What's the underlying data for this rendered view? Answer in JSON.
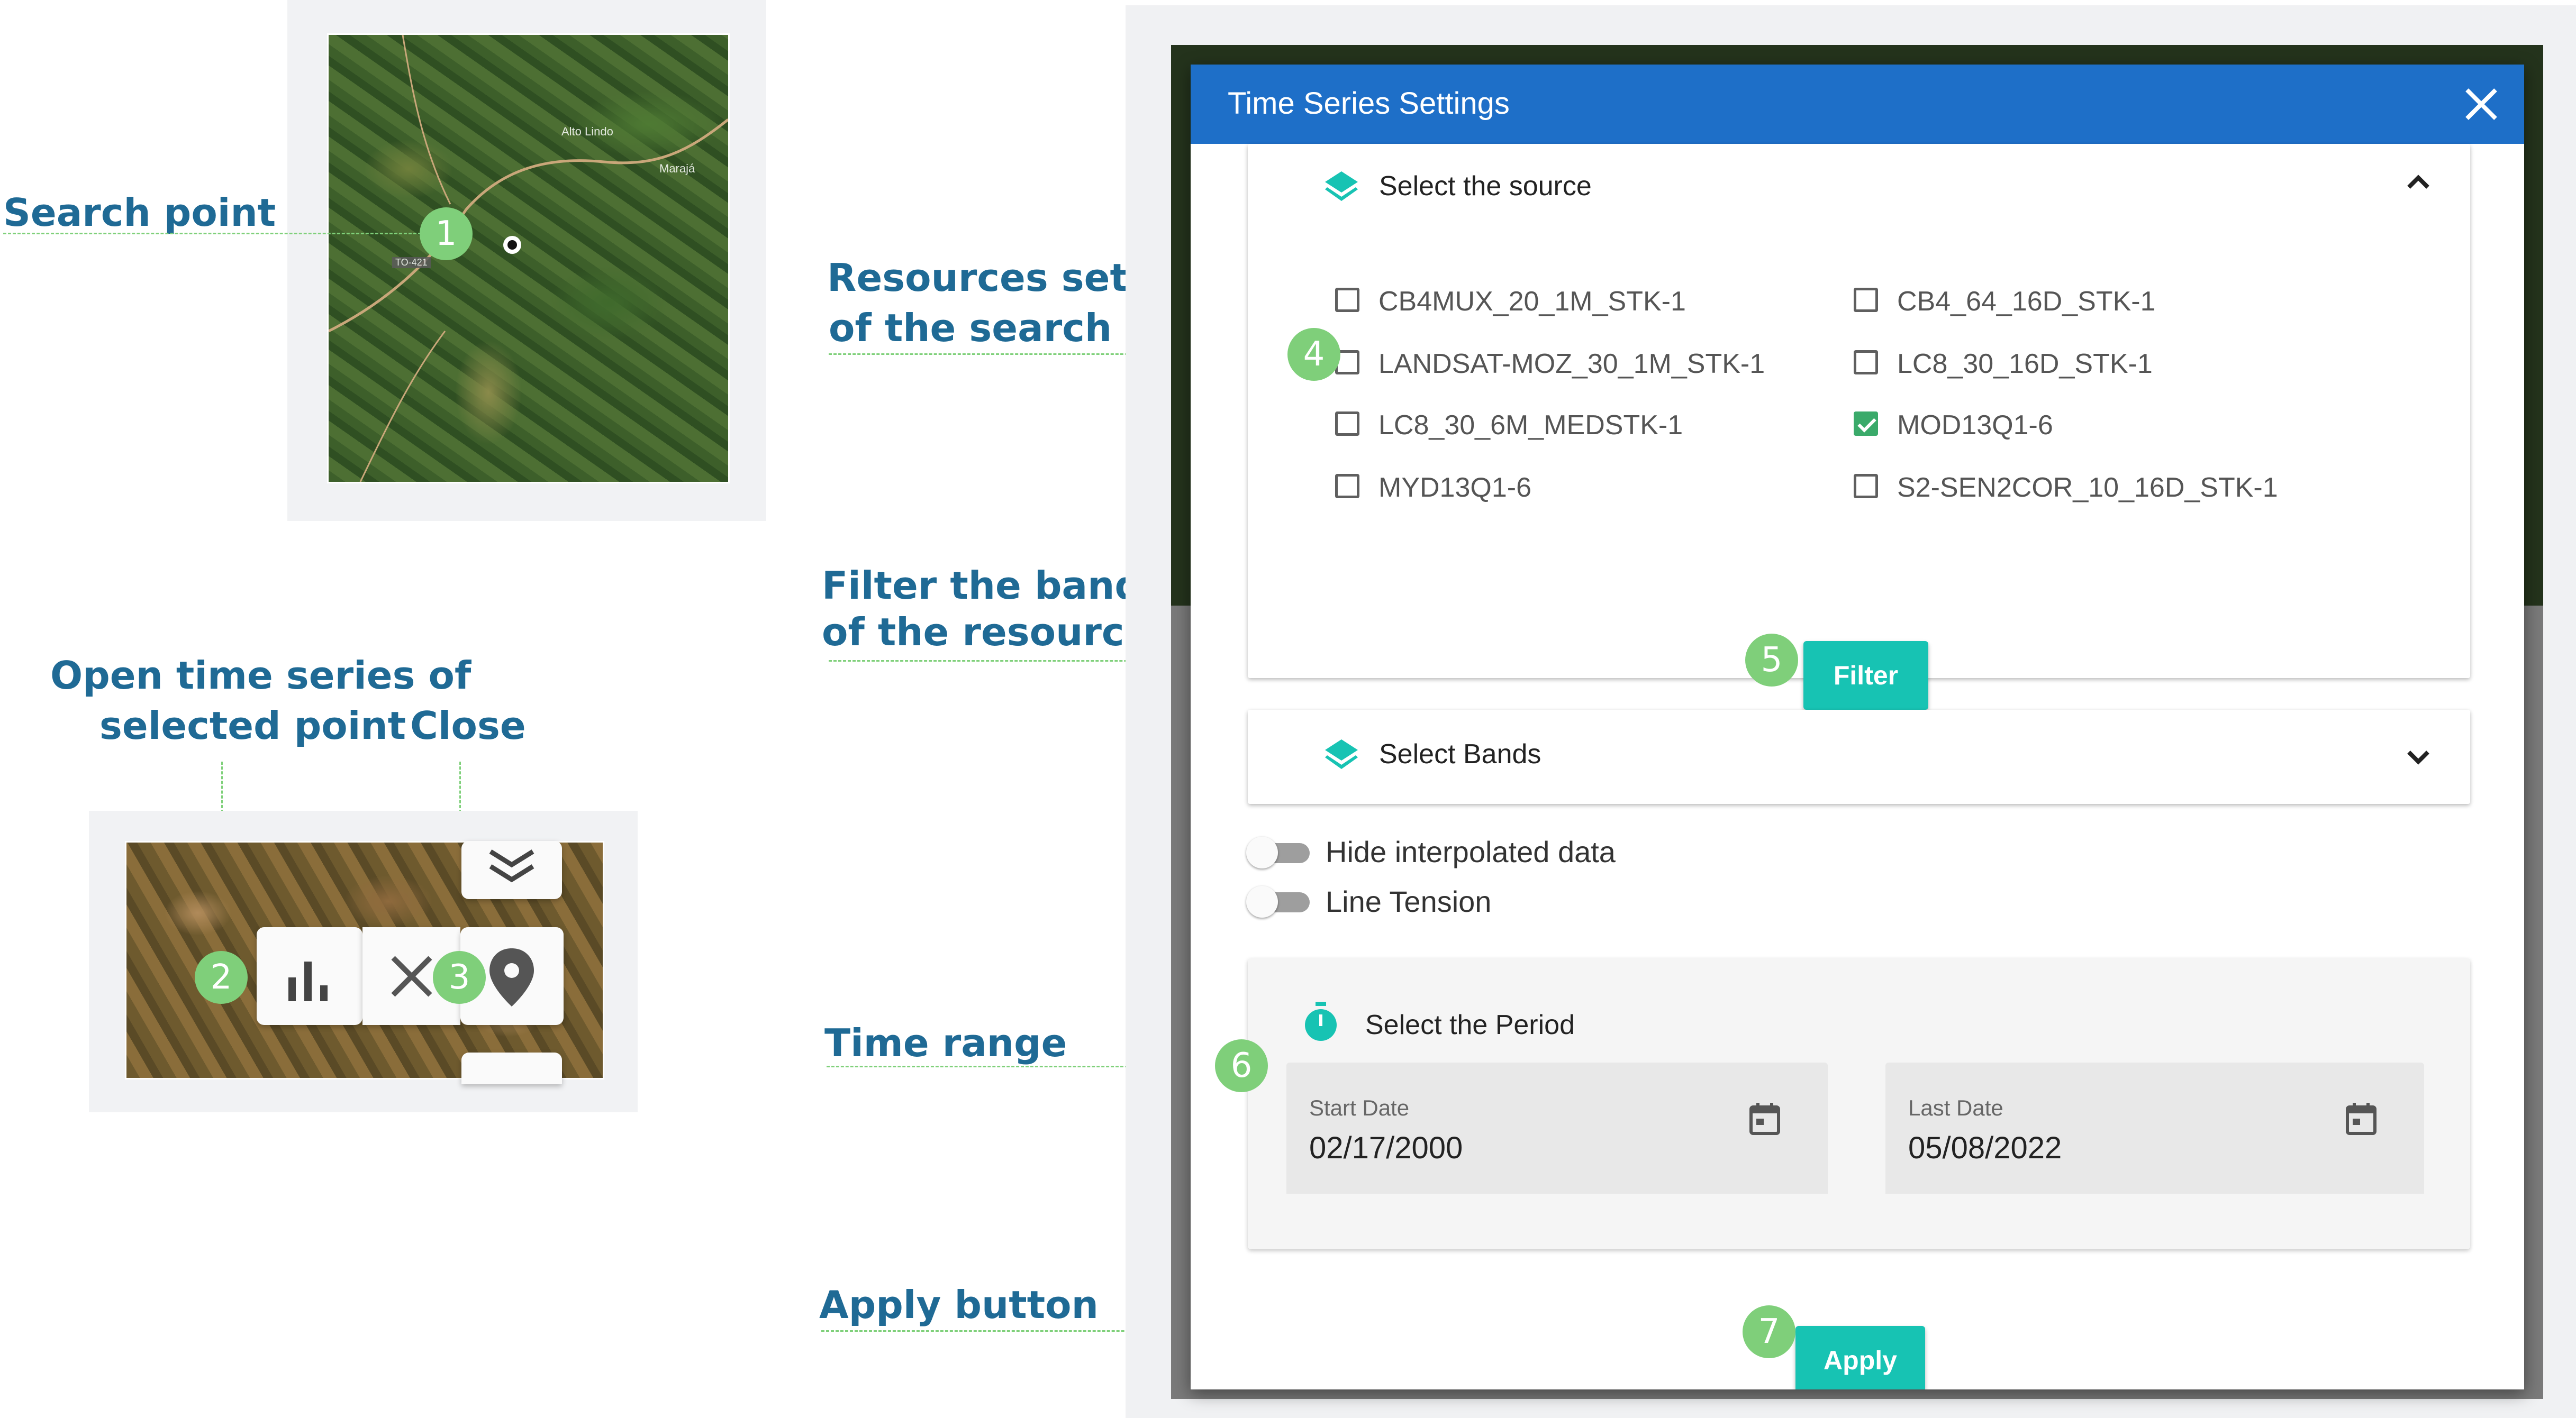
{
  "annotations": {
    "search_point": "Search point",
    "resources_line1": "Resources set",
    "resources_line2": "of the search",
    "filter_line1": "Filter the bands",
    "filter_line2": "of the resources",
    "open_ts_line1": "Open time series of",
    "open_ts_line2": "selected point",
    "close": "Close",
    "time_range": "Time range",
    "apply_button": "Apply button",
    "badges": [
      "1",
      "2",
      "3",
      "4",
      "5",
      "6",
      "7"
    ]
  },
  "map": {
    "labels": [
      "Alto Lindo",
      "Marajá",
      "TO-421"
    ]
  },
  "dialog": {
    "title": "Time Series Settings",
    "source": {
      "title": "Select the source",
      "collections": [
        {
          "label": "CB4MUX_20_1M_STK-1",
          "checked": false
        },
        {
          "label": "CB4_64_16D_STK-1",
          "checked": false
        },
        {
          "label": "LANDSAT-MOZ_30_1M_STK-1",
          "checked": false
        },
        {
          "label": "LC8_30_16D_STK-1",
          "checked": false
        },
        {
          "label": "LC8_30_6M_MEDSTK-1",
          "checked": false
        },
        {
          "label": "MOD13Q1-6",
          "checked": true
        },
        {
          "label": "MYD13Q1-6",
          "checked": false
        },
        {
          "label": "S2-SEN2COR_10_16D_STK-1",
          "checked": false
        }
      ],
      "filter_label": "Filter"
    },
    "bands": {
      "title": "Select Bands"
    },
    "toggles": {
      "hide_interpolated": "Hide interpolated data",
      "line_tension": "Line Tension"
    },
    "period": {
      "title": "Select the Period",
      "start_caption": "Start Date",
      "start_value": "02/17/2000",
      "last_caption": "Last Date",
      "last_value": "05/08/2022"
    },
    "apply_label": "Apply"
  },
  "colors": {
    "header": "#1e6fc8",
    "accent": "#17c3b3",
    "annotation_text": "#1f6a95",
    "badge": "#7fcf7a",
    "checkbox_checked": "#3aaa6a"
  }
}
